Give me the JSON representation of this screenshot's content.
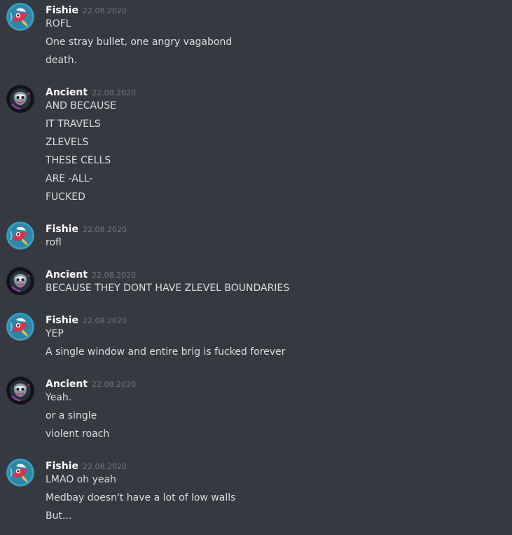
{
  "colors": {
    "background": "#36393f",
    "author": "#ffffff",
    "timestamp": "#72767d",
    "message_text": "#dcddde"
  },
  "messages": [
    {
      "author": "Fishie",
      "timestamp": "22.08.2020",
      "avatar_icon": "fishie-avatar",
      "lines": [
        "ROFL",
        "One stray bullet, one angry vagabond",
        "death."
      ]
    },
    {
      "author": "Ancient",
      "timestamp": "22.08.2020",
      "avatar_icon": "ancient-avatar",
      "lines": [
        "AND BECAUSE",
        "IT TRAVELS",
        "ZLEVELS",
        "THESE CELLS",
        "ARE -ALL-",
        "FUCKED"
      ]
    },
    {
      "author": "Fishie",
      "timestamp": "22.08.2020",
      "avatar_icon": "fishie-avatar",
      "lines": [
        "rofl"
      ]
    },
    {
      "author": "Ancient",
      "timestamp": "22.08.2020",
      "avatar_icon": "ancient-avatar",
      "lines": [
        "BECAUSE THEY DONT HAVE ZLEVEL BOUNDARIES"
      ]
    },
    {
      "author": "Fishie",
      "timestamp": "22.08.2020",
      "avatar_icon": "fishie-avatar",
      "lines": [
        "YEP",
        "A single window and entire brig is fucked forever"
      ]
    },
    {
      "author": "Ancient",
      "timestamp": "22.08.2020",
      "avatar_icon": "ancient-avatar",
      "lines": [
        "Yeah.",
        "or a single",
        "violent roach"
      ]
    },
    {
      "author": "Fishie",
      "timestamp": "22.08.2020",
      "avatar_icon": "fishie-avatar",
      "lines": [
        "LMAO oh yeah",
        "Medbay doesn't have a lot of low walls",
        "But..."
      ]
    }
  ]
}
